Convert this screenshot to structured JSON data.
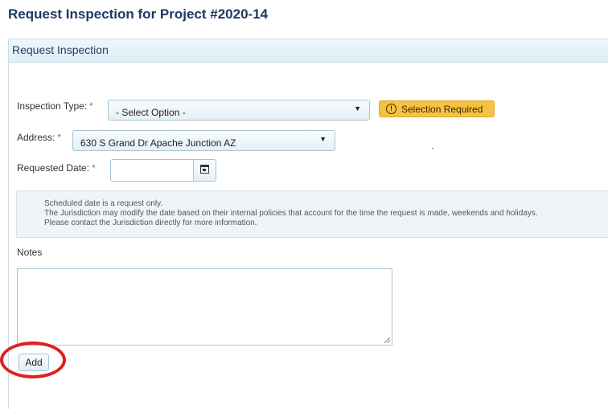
{
  "page": {
    "title": "Request Inspection for Project #2020-14"
  },
  "panel": {
    "header": "Request Inspection"
  },
  "form": {
    "inspection_type": {
      "label": "Inspection Type:",
      "required_mark": "*",
      "value": "- Select Option -"
    },
    "validation": {
      "icon": "warning-icon",
      "text": "Selection Required",
      "color": "#f7c244"
    },
    "address": {
      "label": "Address:",
      "required_mark": "*",
      "value": "630 S Grand Dr Apache Junction AZ"
    },
    "requested_date": {
      "label": "Requested Date:",
      "required_mark": "*",
      "value": "",
      "button_icon": "calendar-icon"
    },
    "info": {
      "line1": "Scheduled date is a request only.",
      "line2": "The Jurisdiction may modify the date based on their internal policies that account for the time the request is made, weekends and holidays.",
      "line3": "Please contact the Jurisdiction directly for more information."
    },
    "notes": {
      "label": "Notes",
      "value": ""
    },
    "add_button": {
      "label": "Add"
    }
  },
  "annotation": {
    "shape": "circle",
    "color": "#e02020",
    "target": "add-button"
  }
}
